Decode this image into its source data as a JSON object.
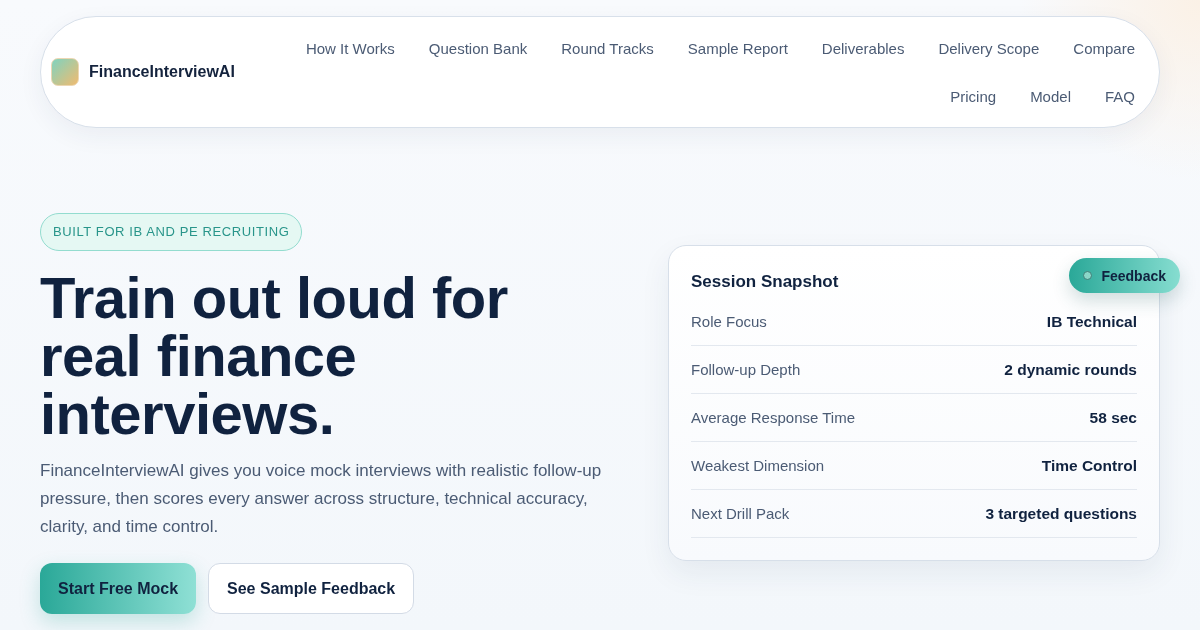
{
  "brand": {
    "name": "FinanceInterviewAI"
  },
  "nav_rows": [
    [
      "How It Works",
      "Question Bank",
      "Round Tracks",
      "Sample Report",
      "Deliverables",
      "Delivery Scope",
      "Compare"
    ],
    [
      "Pricing",
      "Model",
      "FAQ"
    ]
  ],
  "hero": {
    "badge": "BUILT FOR IB AND PE RECRUITING",
    "headline": [
      "Train out loud for",
      "real finance",
      "interviews."
    ],
    "description": "FinanceInterviewAI gives you voice mock interviews with realistic follow-up pressure, then scores every answer across structure, technical accuracy, clarity, and time control.",
    "buttons": [
      {
        "label": "Start Free Mock",
        "kind": "primary"
      },
      {
        "label": "See Sample Feedback",
        "kind": "secondary"
      }
    ]
  },
  "snapshot": {
    "title": "Session Snapshot",
    "chip": "Feedback",
    "rows": [
      {
        "label": "Role Focus",
        "value": "IB Technical"
      },
      {
        "label": "Follow-up Depth",
        "value": "2 dynamic rounds"
      },
      {
        "label": "Average Response Time",
        "value": "58 sec"
      },
      {
        "label": "Weakest Dimension",
        "value": "Time Control"
      },
      {
        "label": "Next Drill Pack",
        "value": "3 targeted questions"
      }
    ]
  }
}
